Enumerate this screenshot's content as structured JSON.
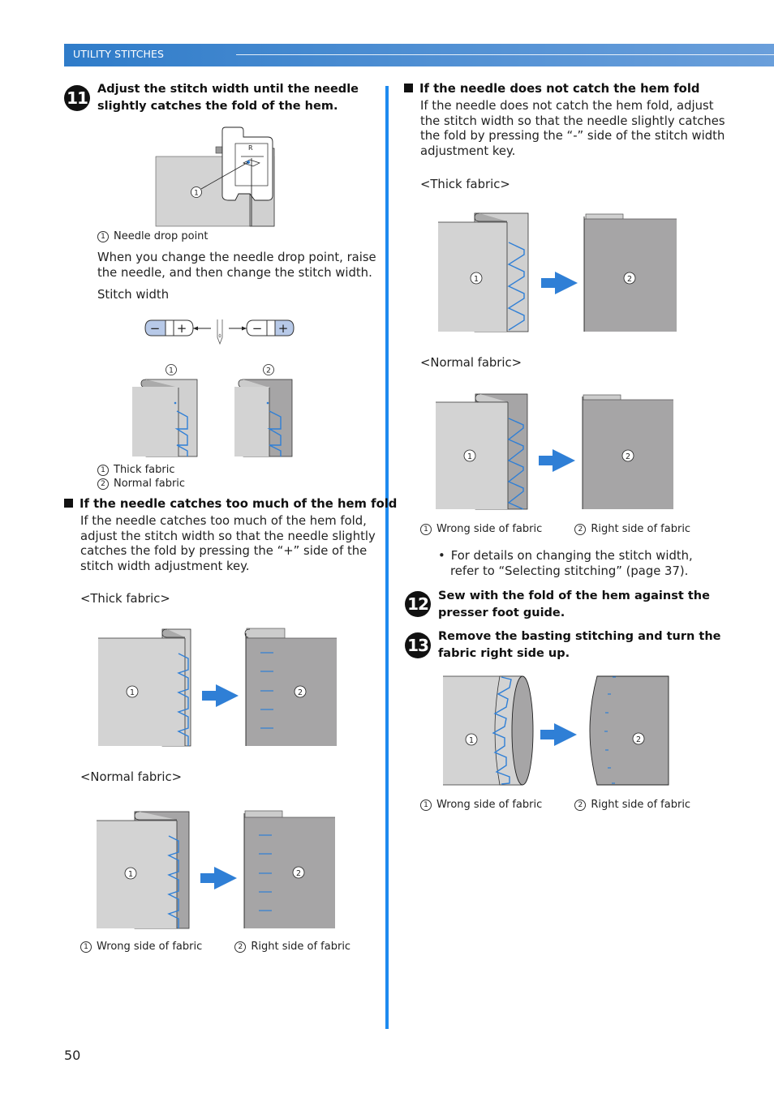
{
  "header": {
    "section_title": "UTILITY STITCHES"
  },
  "left": {
    "step11": {
      "number": "11",
      "text_line1": "Adjust the stitch width until the needle",
      "text_line2": "slightly catches the fold of the hem."
    },
    "figure1": {
      "callout": "1",
      "caption_num": "1",
      "caption": "Needle drop point"
    },
    "note_line1": "When you change the needle drop point, raise",
    "note_line2": "the needle, and then change the stitch width.",
    "stitch_width_label": "Stitch width",
    "key_left": {
      "minus": "−",
      "plus": "+"
    },
    "key_right": {
      "minus": "−",
      "plus": "+"
    },
    "figure2": {
      "label1": "1",
      "label2": "2",
      "legend": [
        {
          "num": "1",
          "text": "Thick fabric"
        },
        {
          "num": "2",
          "text": "Normal fabric"
        }
      ]
    },
    "too_much": {
      "heading": "If the needle catches too much of the hem fold",
      "lines": [
        "If the needle catches too much of the hem fold,",
        "adjust the stitch width so that the needle slightly",
        "catches the fold by pressing the “+” side of the",
        "stitch width adjustment key."
      ],
      "thick_label": "<Thick fabric>",
      "normal_label": "<Normal fabric>",
      "legend": [
        {
          "num": "1",
          "text": "Wrong side of fabric"
        },
        {
          "num": "2",
          "text": "Right side of fabric"
        }
      ]
    }
  },
  "right": {
    "not_catch": {
      "heading": "If the needle does not catch the hem fold",
      "lines": [
        "If the needle does not catch the hem fold, adjust",
        "the stitch width so that the needle slightly catches",
        "the fold by pressing the “-” side of the stitch width",
        "adjustment key."
      ],
      "thick_label": "<Thick fabric>",
      "normal_label": "<Normal fabric>",
      "legend": [
        {
          "num": "1",
          "text": "Wrong side of fabric"
        },
        {
          "num": "2",
          "text": "Right side of fabric"
        }
      ]
    },
    "bullet_line1": "For details on changing the stitch width,",
    "bullet_line2": "refer to “Selecting stitching” (page 37).",
    "step12": {
      "number": "12",
      "text_line1": "Sew with the fold of the hem against the",
      "text_line2": "presser foot guide."
    },
    "step13": {
      "number": "13",
      "text_line1": "Remove the basting stitching and turn the",
      "text_line2": "fabric right side up."
    },
    "final_legend": [
      {
        "num": "1",
        "text": "Wrong side of fabric"
      },
      {
        "num": "2",
        "text": "Right side of fabric"
      }
    ]
  },
  "footer": {
    "page_number": "50"
  },
  "colors": {
    "accent": "#2f7cc9",
    "divider": "#1e8bf0",
    "stitch": "#2f7fd6",
    "fabric_light": "#d3d3d3",
    "fabric_dark": "#a6a5a6"
  }
}
